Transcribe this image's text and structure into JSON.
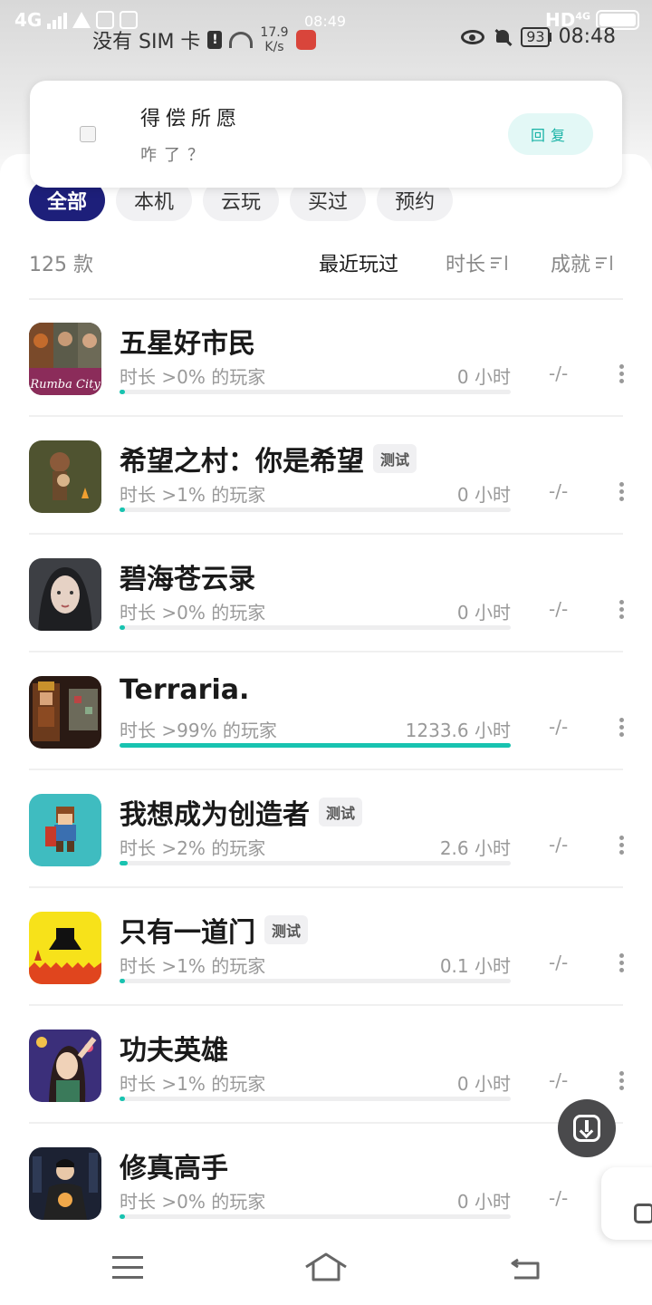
{
  "status_bar": {
    "network_left": "4G",
    "sim_text": "没有 SIM 卡",
    "sim_badge": "!",
    "speed_value": "17.9",
    "speed_unit": "K/s",
    "clock_top": "08:49",
    "hd_label": "HD",
    "network_right": "4G",
    "battery_level": "93",
    "clock": "08:48"
  },
  "notification": {
    "title": "得偿所愿",
    "message": "咋了？",
    "reply_label": "回复"
  },
  "filter_tabs": [
    {
      "label": "全部",
      "active": true
    },
    {
      "label": "本机",
      "active": false
    },
    {
      "label": "云玩",
      "active": false
    },
    {
      "label": "买过",
      "active": false
    },
    {
      "label": "预约",
      "active": false
    }
  ],
  "list_header": {
    "count": "125 款",
    "sort_recent": "最近玩过",
    "sort_duration": "时长",
    "sort_achievement": "成就"
  },
  "games": [
    {
      "name": "五星好市民",
      "tag": "",
      "percentile": "时长 >0% 的玩家",
      "hours": "0 小时",
      "progress": 0.0,
      "achievement": "-/-",
      "icon": "rumba-city-icon"
    },
    {
      "name": "希望之村：你是希望",
      "tag": "测试",
      "percentile": "时长 >1% 的玩家",
      "hours": "0 小时",
      "progress": 0.01,
      "achievement": "-/-",
      "icon": "village-hope-icon"
    },
    {
      "name": "碧海苍云录",
      "tag": "",
      "percentile": "时长 >0% 的玩家",
      "hours": "0 小时",
      "progress": 0.0,
      "achievement": "-/-",
      "icon": "bihai-portrait-icon"
    },
    {
      "name": "Terraria.",
      "tag": "",
      "percentile": "时长 >99% 的玩家",
      "hours": "1233.6 小时",
      "progress": 1.0,
      "achievement": "-/-",
      "icon": "terraria-icon"
    },
    {
      "name": "我想成为创造者",
      "tag": "测试",
      "percentile": "时长 >2% 的玩家",
      "hours": "2.6 小时",
      "progress": 0.02,
      "achievement": "-/-",
      "icon": "creator-pixel-icon"
    },
    {
      "name": "只有一道门",
      "tag": "测试",
      "percentile": "时长 >1% 的玩家",
      "hours": "0.1 小时",
      "progress": 0.01,
      "achievement": "-/-",
      "icon": "one-door-icon"
    },
    {
      "name": "功夫英雄",
      "tag": "",
      "percentile": "时长 >1% 的玩家",
      "hours": "0 小时",
      "progress": 0.01,
      "achievement": "-/-",
      "icon": "kungfu-hero-icon"
    },
    {
      "name": "修真高手",
      "tag": "",
      "percentile": "时长 >0% 的玩家",
      "hours": "0 小时",
      "progress": 0.0,
      "achievement": "-/-",
      "icon": "xiuzhen-master-icon"
    }
  ],
  "colors": {
    "accent": "#18c3b0",
    "active_tab": "#1d1f7a",
    "reply_bg": "#e3f8f6"
  }
}
